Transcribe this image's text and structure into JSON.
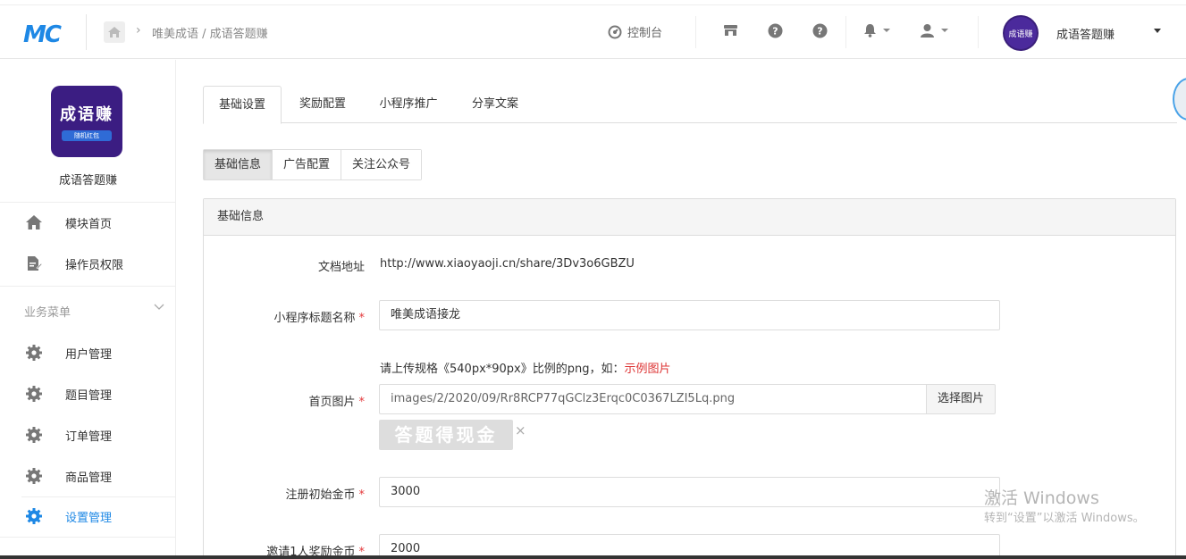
{
  "header": {
    "logo_text": "MC",
    "breadcrumb": "唯美成语 / 成语答题赚",
    "console_label": "控制台",
    "user_name": "成语答题赚",
    "avatar_text": "成语赚"
  },
  "sidebar": {
    "app_logo_title": "成语赚",
    "app_logo_sub": "随机红包",
    "app_name": "成语答题赚",
    "top_items": [
      {
        "label": "模块首页",
        "icon": "home-icon"
      },
      {
        "label": "操作员权限",
        "icon": "edit-doc-icon"
      }
    ],
    "group_label": "业务菜单",
    "group_items": [
      {
        "label": "用户管理",
        "icon": "gear-icon"
      },
      {
        "label": "题目管理",
        "icon": "gear-icon"
      },
      {
        "label": "订单管理",
        "icon": "gear-icon"
      },
      {
        "label": "商品管理",
        "icon": "gear-icon"
      },
      {
        "label": "设置管理",
        "icon": "gear-icon",
        "active": true
      }
    ]
  },
  "tabs": [
    "基础设置",
    "奖励配置",
    "小程序推广",
    "分享文案"
  ],
  "subtabs": [
    "基础信息",
    "广告配置",
    "关注公众号"
  ],
  "panel": {
    "title": "基础信息",
    "doc_label": "文档地址",
    "doc_value": "http://www.xiaoyaoji.cn/share/3Dv3o6GBZU",
    "mp_title_label": "小程序标题名称",
    "mp_title_value": "唯美成语接龙",
    "upload_hint": "请上传规格《540px*90px》比例的png，如：",
    "upload_hint_link": "示例图片",
    "home_img_label": "首页图片",
    "home_img_value": "images/2/2020/09/Rr8RCP77qGClz3Erqc0C0367LZI5Lq.png",
    "pick_button": "选择图片",
    "thumb_text": "答题得现金",
    "thumb_close": "×",
    "reg_coins_label": "注册初始金币",
    "reg_coins_value": "3000",
    "invite_label": "邀请1人奖励金币",
    "invite_value": "2000"
  },
  "watermark": {
    "line1": "激活 Windows",
    "line2": "转到“设置”以激活 Windows。"
  },
  "colors": {
    "accent": "#1e88e5",
    "required": "#e4393c"
  }
}
